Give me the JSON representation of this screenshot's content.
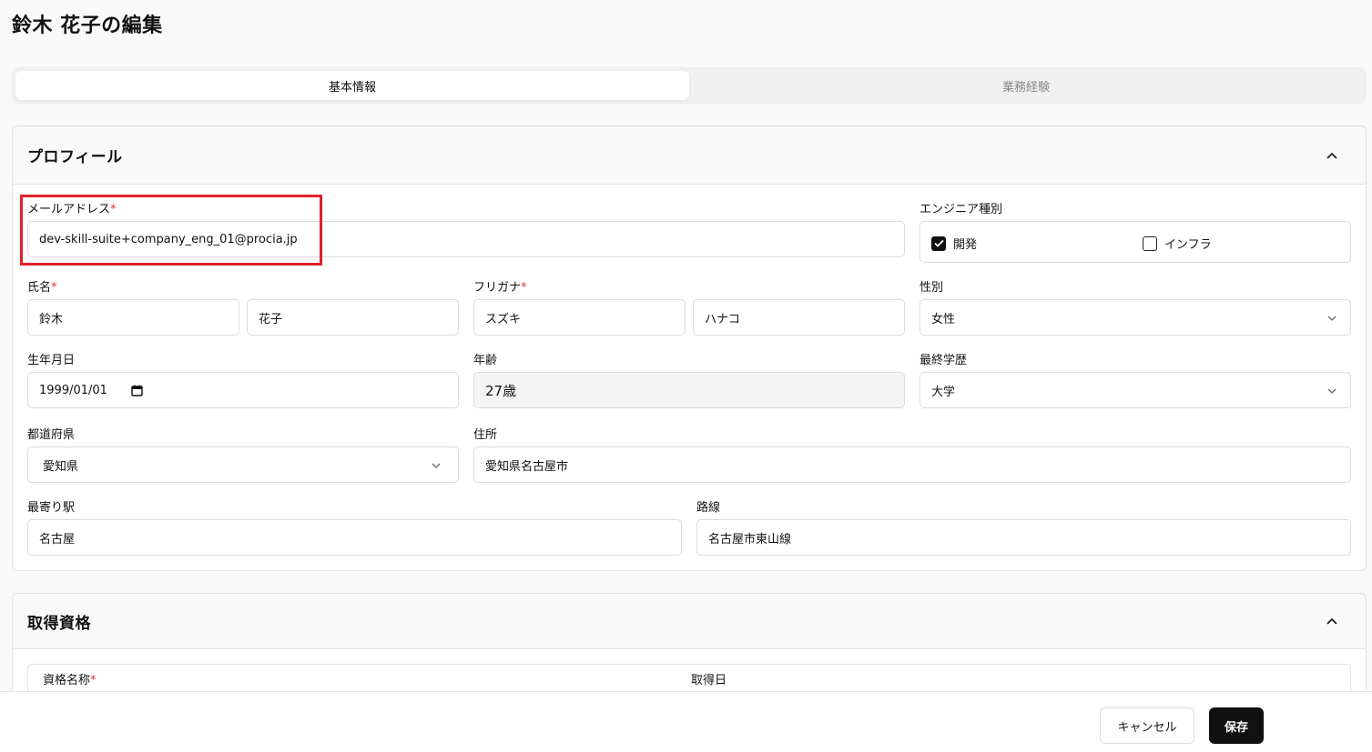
{
  "page_title": "鈴木 花子の編集",
  "tabs": [
    {
      "label": "基本情報",
      "active": true
    },
    {
      "label": "業務経験",
      "active": false
    }
  ],
  "profile": {
    "title": "プロフィール",
    "email": {
      "label": "メールアドレス",
      "required": "*",
      "value": "dev-skill-suite+company_eng_01@procia.jp"
    },
    "engineer_type": {
      "label": "エンジニア種別",
      "options": [
        {
          "label": "開発",
          "checked": true
        },
        {
          "label": "インフラ",
          "checked": false
        }
      ]
    },
    "name": {
      "label": "氏名",
      "required": "*",
      "last": "鈴木",
      "first": "花子"
    },
    "kana": {
      "label": "フリガナ",
      "required": "*",
      "last": "スズキ",
      "first": "ハナコ"
    },
    "gender": {
      "label": "性別",
      "value": "女性"
    },
    "birthdate": {
      "label": "生年月日",
      "value": "1999/01/01"
    },
    "age": {
      "label": "年齢",
      "value": "27歳"
    },
    "education": {
      "label": "最終学歴",
      "value": "大学"
    },
    "prefecture": {
      "label": "都道府県",
      "value": "愛知県"
    },
    "address": {
      "label": "住所",
      "value": "愛知県名古屋市"
    },
    "station": {
      "label": "最寄り駅",
      "value": "名古屋"
    },
    "line": {
      "label": "路線",
      "value": "名古屋市東山線"
    }
  },
  "qualifications": {
    "title": "取得資格",
    "col_name": "資格名称",
    "col_name_required": "*",
    "col_date": "取得日"
  },
  "footer": {
    "cancel_label": "キャンセル",
    "save_label": "保存"
  },
  "colors": {
    "highlight": "#e0202a",
    "required": "#dd3333",
    "primary_button": "#111111"
  }
}
